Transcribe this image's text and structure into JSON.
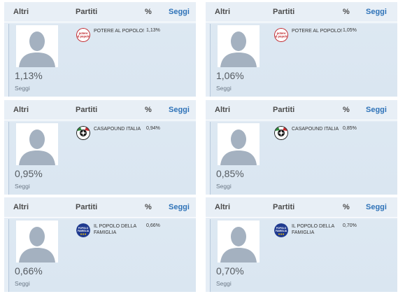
{
  "headers": {
    "altri": "Altri",
    "partiti": "Partiti",
    "pct": "%",
    "seggi": "Seggi"
  },
  "colors": {
    "accent": "#2f73b8",
    "card_bg": "#dde8f2",
    "header_text": "#4b4b4b"
  },
  "cards": [
    {
      "party": "POTERE AL POPOLO!",
      "party_pct": "1,13%",
      "big_pct": "1,13%",
      "seggi": "Seggi",
      "logo_icon": "potere-al-popolo-logo"
    },
    {
      "party": "POTERE AL POPOLO!",
      "party_pct": "1,05%",
      "big_pct": "1,06%",
      "seggi": "Seggi",
      "logo_icon": "potere-al-popolo-logo"
    },
    {
      "party": "CASAPOUND ITALIA",
      "party_pct": "0,94%",
      "big_pct": "0,95%",
      "seggi": "Seggi",
      "logo_icon": "casapound-logo"
    },
    {
      "party": "CASAPOUND ITALIA",
      "party_pct": "0,85%",
      "big_pct": "0,85%",
      "seggi": "Seggi",
      "logo_icon": "casapound-logo"
    },
    {
      "party": "IL POPOLO DELLA FAMIGLIA",
      "party_pct": "0,66%",
      "big_pct": "0,66%",
      "seggi": "Seggi",
      "logo_icon": "popolo-famiglia-logo"
    },
    {
      "party": "IL POPOLO DELLA FAMIGLIA",
      "party_pct": "0,70%",
      "big_pct": "0,70%",
      "seggi": "Seggi",
      "logo_icon": "popolo-famiglia-logo"
    }
  ]
}
